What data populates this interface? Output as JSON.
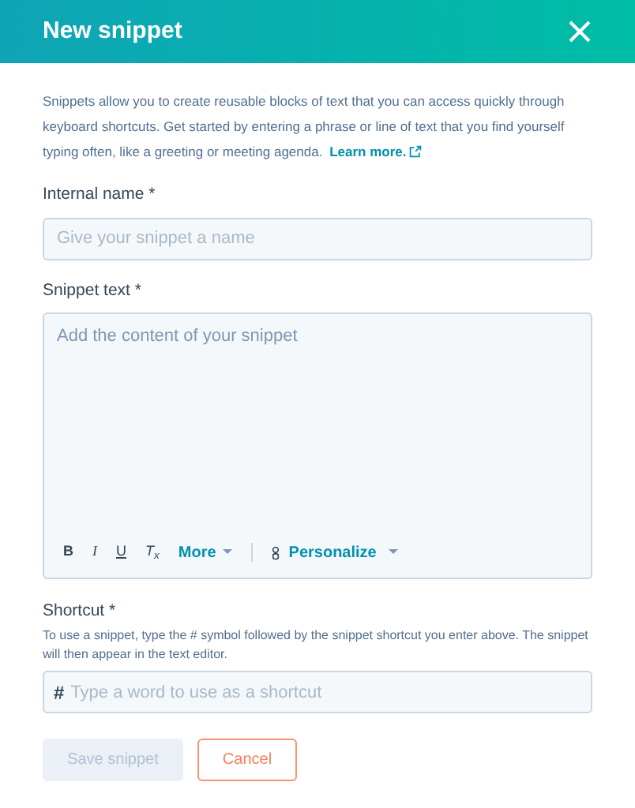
{
  "dialog": {
    "title": "New snippet"
  },
  "intro": {
    "text": "Snippets allow you to create reusable blocks of text that you can access quickly through keyboard shortcuts. Get started by entering a phrase or line of text that you find yourself typing often, like a greeting or meeting agenda.",
    "link": "Learn more."
  },
  "name_field": {
    "label": "Internal name *",
    "placeholder": "Give your snippet a name"
  },
  "text_field": {
    "label": "Snippet text *",
    "placeholder": "Add the content of your snippet",
    "toolbar": [
      {
        "kind": "bold",
        "label": "B"
      },
      {
        "kind": "italic",
        "label": "I"
      },
      {
        "kind": "underline",
        "label": "U"
      },
      {
        "kind": "clear",
        "label": "T$_{x}$"
      },
      {
        "kind": "menu",
        "label": "More"
      },
      {
        "kind": "divider"
      },
      {
        "kind": "personalize",
        "label": "Personalize"
      }
    ]
  },
  "shortcut_field": {
    "label": "Shortcut *",
    "help": "To use a snippet, type the # symbol followed by the snippet shortcut you enter above. The snippet will then appear in the text editor.",
    "prefix": "#",
    "placeholder": "Type a word to use as a shortcut"
  },
  "buttons": [
    {
      "kind": "primary",
      "label": "Save snippet",
      "disabled": true
    },
    {
      "kind": "secondary",
      "label": "Cancel",
      "disabled": false
    }
  ]
}
